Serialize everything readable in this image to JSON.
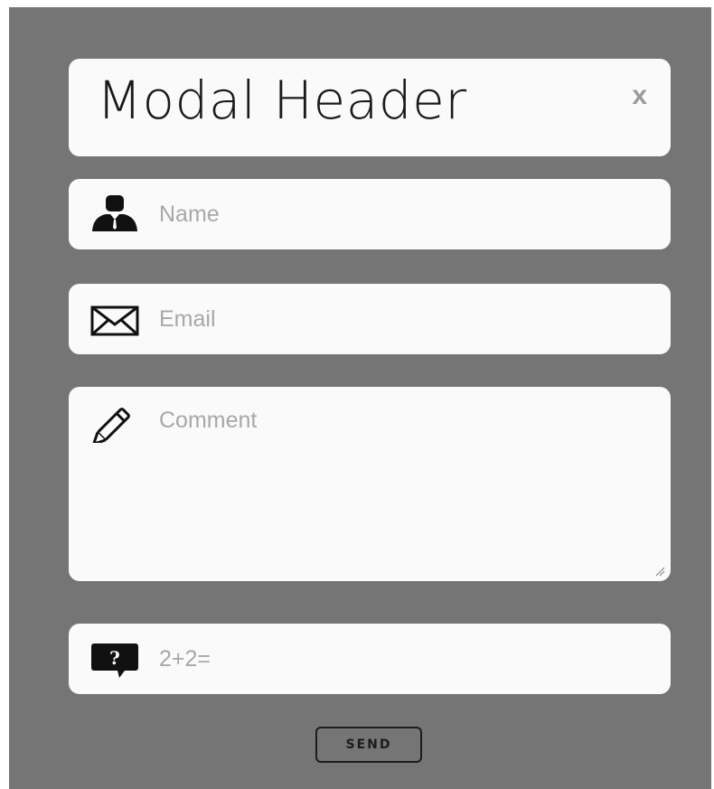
{
  "modal": {
    "header": {
      "title": "Modal Header",
      "close_label": "x"
    },
    "fields": {
      "name": {
        "placeholder": "Name",
        "value": "",
        "icon": "user-icon"
      },
      "email": {
        "placeholder": "Email",
        "value": "",
        "icon": "envelope-icon"
      },
      "comment": {
        "placeholder": "Comment",
        "value": "",
        "icon": "pencil-icon"
      },
      "captcha": {
        "placeholder": "2+2=",
        "value": "",
        "icon": "question-bubble-icon"
      }
    },
    "send_label": "SEND"
  },
  "colors": {
    "overlay_bg": "#757575",
    "card_bg": "#fafafa",
    "placeholder": "#a8a8a8",
    "close": "#9a9a9a",
    "button_border": "#1c1c1c"
  }
}
